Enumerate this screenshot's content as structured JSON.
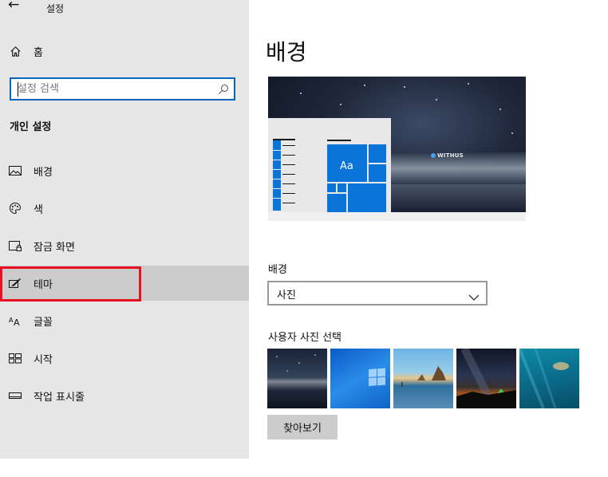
{
  "window": {
    "title": "설정",
    "back_icon": "back-arrow-icon"
  },
  "sidebar": {
    "home_label": "홈",
    "search": {
      "placeholder": "설정 검색",
      "value": ""
    },
    "section_title": "개인 설정",
    "items": [
      {
        "label": "배경",
        "icon": "picture-icon"
      },
      {
        "label": "색",
        "icon": "palette-icon"
      },
      {
        "label": "잠금 화면",
        "icon": "lock-screen-icon"
      },
      {
        "label": "테마",
        "icon": "theme-brush-icon",
        "selected": true
      },
      {
        "label": "글꼴",
        "icon": "font-icon"
      },
      {
        "label": "시작",
        "icon": "start-icon"
      },
      {
        "label": "작업 표시줄",
        "icon": "taskbar-icon"
      }
    ],
    "highlight_color": "#e81123"
  },
  "main": {
    "title": "배경",
    "preview": {
      "tile_text": "Aa",
      "watermark": "WITHUS"
    },
    "background_label": "배경",
    "background_select": {
      "value": "사진"
    },
    "choose_picture_label": "사용자 사진 선택",
    "thumbnails": [
      "night-sky-lake",
      "windows-blue",
      "rocky-beach",
      "milky-way-tent",
      "underwater-turtle"
    ],
    "browse_button": "찾아보기"
  },
  "colors": {
    "accent": "#0067c0",
    "tile_blue": "#0a74d8",
    "sidebar_bg": "#e6e6e6",
    "selected_bg": "#cccccc"
  }
}
